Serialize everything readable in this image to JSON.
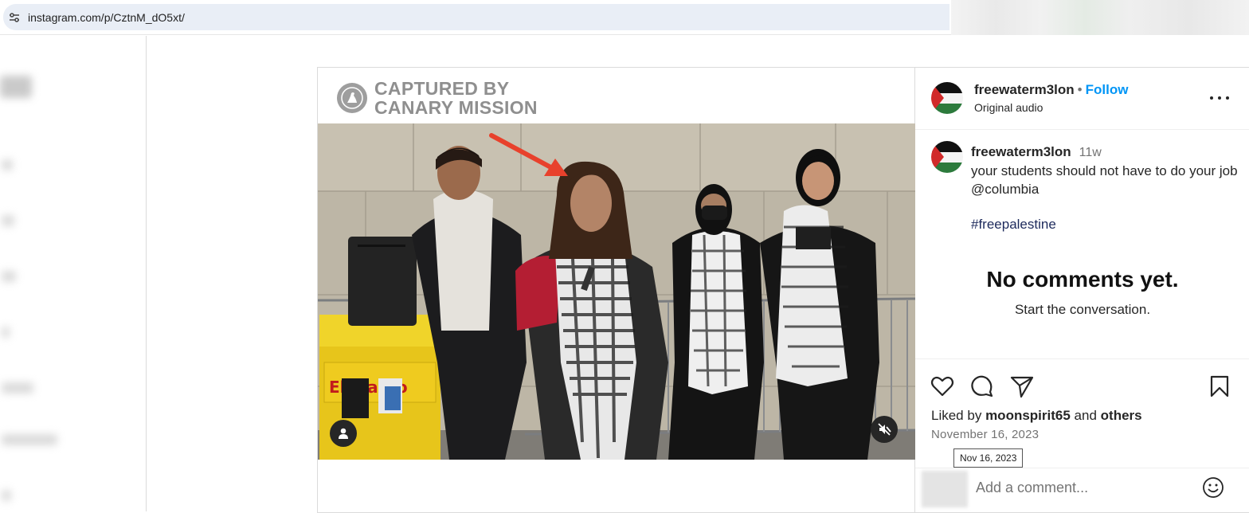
{
  "browser": {
    "url": "instagram.com/p/CztnM_dO5xt/"
  },
  "watermark": {
    "line1": "CAPTURED BY",
    "line2": "CANARY MISSION"
  },
  "post_header": {
    "username": "freewaterm3lon",
    "separator": "•",
    "follow_label": "Follow",
    "audio_label": "Original audio"
  },
  "caption": {
    "username": "freewaterm3lon",
    "time_ago": "11w",
    "text": "your students should not have to do your job @columbia",
    "hashtag": "#freepalestine"
  },
  "comments": {
    "empty_title": "No comments yet.",
    "empty_subtitle": "Start the conversation."
  },
  "engagement": {
    "liked_by_prefix": "Liked by",
    "liked_by_user": "moonspirit65",
    "liked_by_and": "and",
    "liked_by_others": "others",
    "date": "November 16, 2023",
    "date_tooltip": "Nov 16, 2023"
  },
  "comment_box": {
    "placeholder": "Add a comment..."
  },
  "colors": {
    "accent": "#0095f6",
    "text": "#262626",
    "muted": "#737373",
    "arrow": "#e8412c"
  },
  "icons": [
    "site-settings-icon",
    "canary-logo-icon",
    "user-tag-icon",
    "muted-audio-icon",
    "more-options-icon",
    "heart-icon",
    "comment-icon",
    "share-icon",
    "bookmark-icon",
    "emoji-icon"
  ]
}
